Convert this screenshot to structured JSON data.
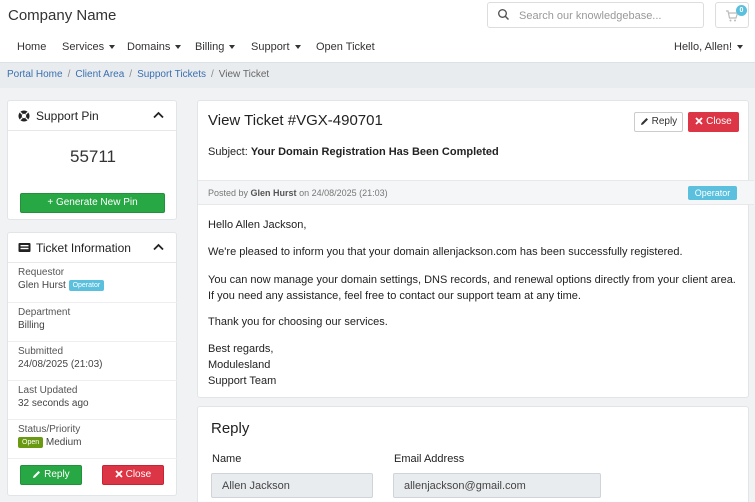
{
  "header": {
    "brand": "Company Name",
    "search_placeholder": "Search our knowledgebase...",
    "cart_count": "0"
  },
  "nav": {
    "items": [
      {
        "label": "Home",
        "dropdown": false
      },
      {
        "label": "Services",
        "dropdown": true
      },
      {
        "label": "Domains",
        "dropdown": true
      },
      {
        "label": "Billing",
        "dropdown": true
      },
      {
        "label": "Support",
        "dropdown": true
      },
      {
        "label": "Open Ticket",
        "dropdown": false
      }
    ],
    "user_greeting": "Hello, Allen!"
  },
  "breadcrumb": [
    "Portal Home",
    "Client Area",
    "Support Tickets",
    "View Ticket"
  ],
  "support_pin": {
    "title": "Support Pin",
    "pin": "55711",
    "generate_label": "+ Generate New Pin"
  },
  "ticket_info": {
    "title": "Ticket Information",
    "requestor_label": "Requestor",
    "requestor": "Glen Hurst",
    "requestor_badge": "Operator",
    "department_label": "Department",
    "department": "Billing",
    "submitted_label": "Submitted",
    "submitted": "24/08/2025 (21:03)",
    "last_updated_label": "Last Updated",
    "last_updated": "32 seconds ago",
    "status_label": "Status/Priority",
    "status_badge": "Open",
    "priority": "Medium",
    "reply_label": "Reply",
    "close_label": "Close"
  },
  "ticket": {
    "title": "View Ticket #VGX-490701",
    "subject_prefix": "Subject:",
    "subject": "Your Domain Registration Has Been Completed",
    "reply_label": "Reply",
    "close_label": "Close",
    "posted_prefix": "Posted by",
    "posted_by": "Glen Hurst",
    "posted_on": "on 24/08/2025 (21:03)",
    "posted_badge": "Operator",
    "message": {
      "greeting": "Hello Allen Jackson,",
      "p1": "We're pleased to inform you that your domain allenjackson.com has been successfully registered.",
      "p2": "You can now manage your domain settings, DNS records, and renewal options directly from your client area. If you need any assistance, feel free to contact our support team at any time.",
      "p3": "Thank you for choosing our services.",
      "sign1": "Best regards,",
      "sign2": "Modulesland",
      "sign3": "Support Team"
    }
  },
  "reply_form": {
    "title": "Reply",
    "name_label": "Name",
    "name_value": "Allen Jackson",
    "email_label": "Email Address",
    "email_value": "allenjackson@gmail.com"
  },
  "colors": {
    "green": "#28a745",
    "red": "#dc3545",
    "info": "#5bc0de",
    "link": "#3a6fb0"
  }
}
